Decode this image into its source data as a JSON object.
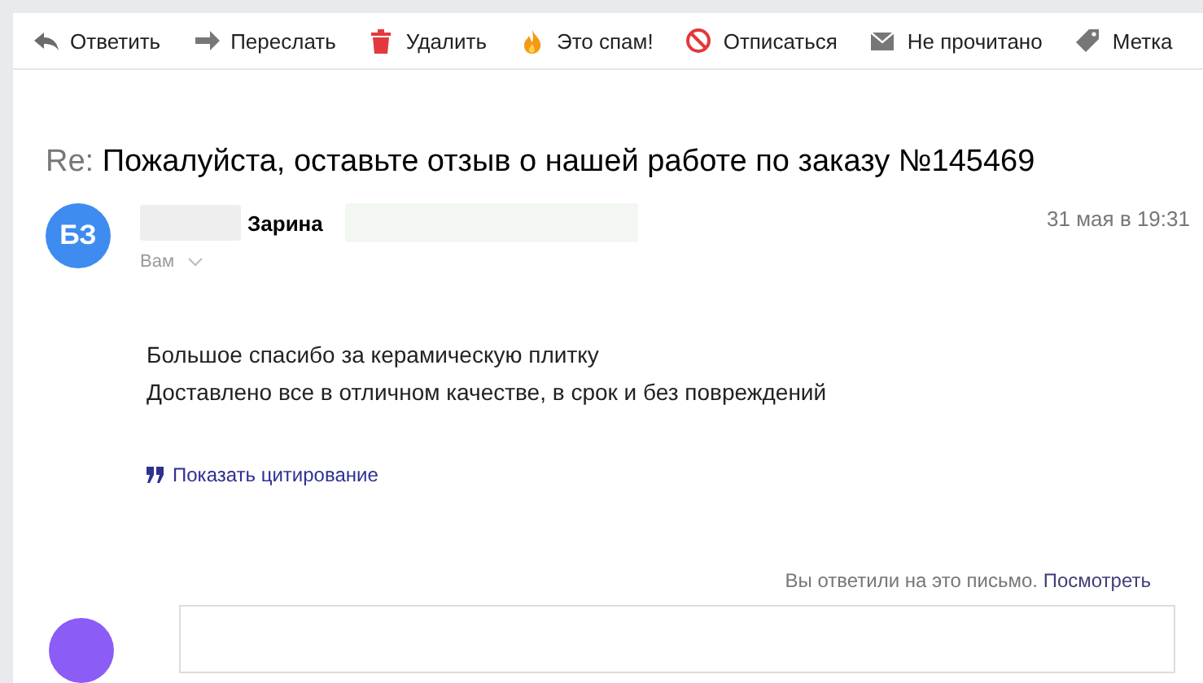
{
  "toolbar": [
    {
      "kind": "reply",
      "label": "Ответить"
    },
    {
      "kind": "forward",
      "label": "Переслать"
    },
    {
      "kind": "delete",
      "label": "Удалить"
    },
    {
      "kind": "spam",
      "label": "Это спам!"
    },
    {
      "kind": "unsubscribe",
      "label": "Отписаться"
    },
    {
      "kind": "unread",
      "label": "Не прочитано"
    },
    {
      "kind": "label",
      "label": "Метка"
    }
  ],
  "subject": {
    "prefix": "Re:",
    "text": "Пожалуйста, оставьте отзыв о нашей работе по заказу №145469"
  },
  "message": {
    "avatar": "БЗ",
    "sender": "Зарина",
    "recipient": "Вам",
    "date": "31 мая в 19:31",
    "body": [
      "Большое спасибо за керамическую плитку",
      "Доставлено все в отличном качестве, в срок и без повреждений"
    ],
    "quote_link": "Показать цитирование"
  },
  "replied": {
    "text": "Вы ответили на это письмо.",
    "link": "Посмотреть"
  }
}
